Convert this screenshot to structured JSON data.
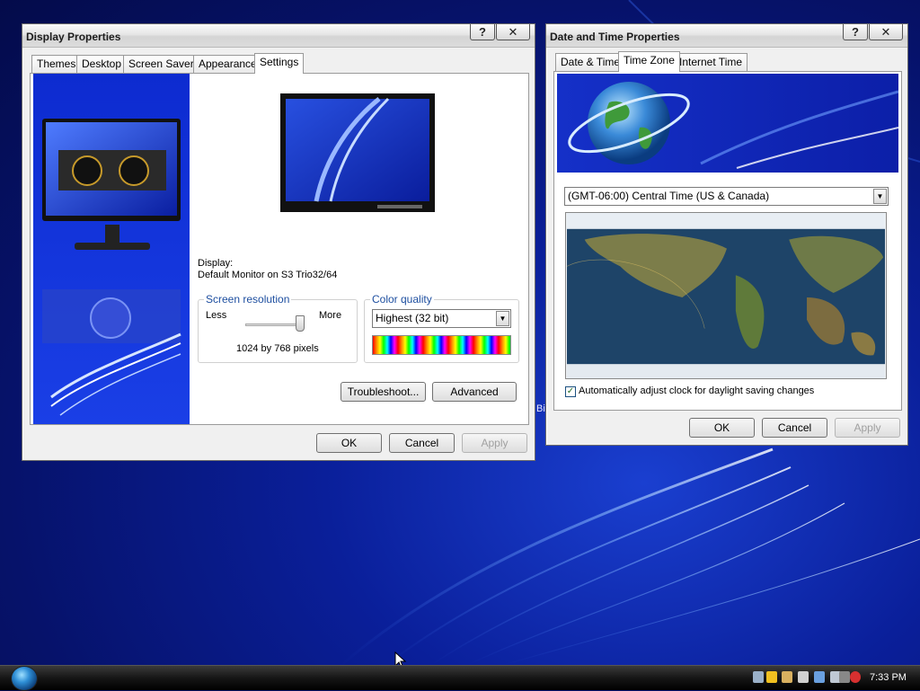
{
  "display_window": {
    "title": "Display Properties",
    "tabs": [
      "Themes",
      "Desktop",
      "Screen Saver",
      "Appearance",
      "Settings"
    ],
    "active_tab": "Settings",
    "display_label": "Display:",
    "display_value": "Default Monitor on S3 Trio32/64",
    "resolution": {
      "group_label": "Screen resolution",
      "less": "Less",
      "more": "More",
      "value": "1024 by 768 pixels",
      "slider_level": 1.0
    },
    "color_quality": {
      "group_label": "Color quality",
      "selected": "Highest (32 bit)"
    },
    "buttons": {
      "troubleshoot": "Troubleshoot...",
      "advanced": "Advanced",
      "ok": "OK",
      "cancel": "Cancel",
      "apply": "Apply"
    }
  },
  "datetime_window": {
    "title": "Date and Time Properties",
    "tabs": [
      "Date & Time",
      "Time Zone",
      "Internet Time"
    ],
    "active_tab": "Time Zone",
    "timezone_selected": "(GMT-06:00) Central Time (US & Canada)",
    "dst_checkbox_label": "Automatically adjust clock for daylight saving changes",
    "dst_checked": true,
    "buttons": {
      "ok": "OK",
      "cancel": "Cancel",
      "apply": "Apply"
    }
  },
  "title_buttons": {
    "help": "?",
    "close": "✕"
  },
  "desktop_stray_text": "Bi",
  "taskbar": {
    "clock": "7:33 PM"
  },
  "colors": {
    "desktop_blue": "#0a1f9a",
    "group_label_blue": "#1e4fa0",
    "disabled_text": "#a0a0a0"
  }
}
